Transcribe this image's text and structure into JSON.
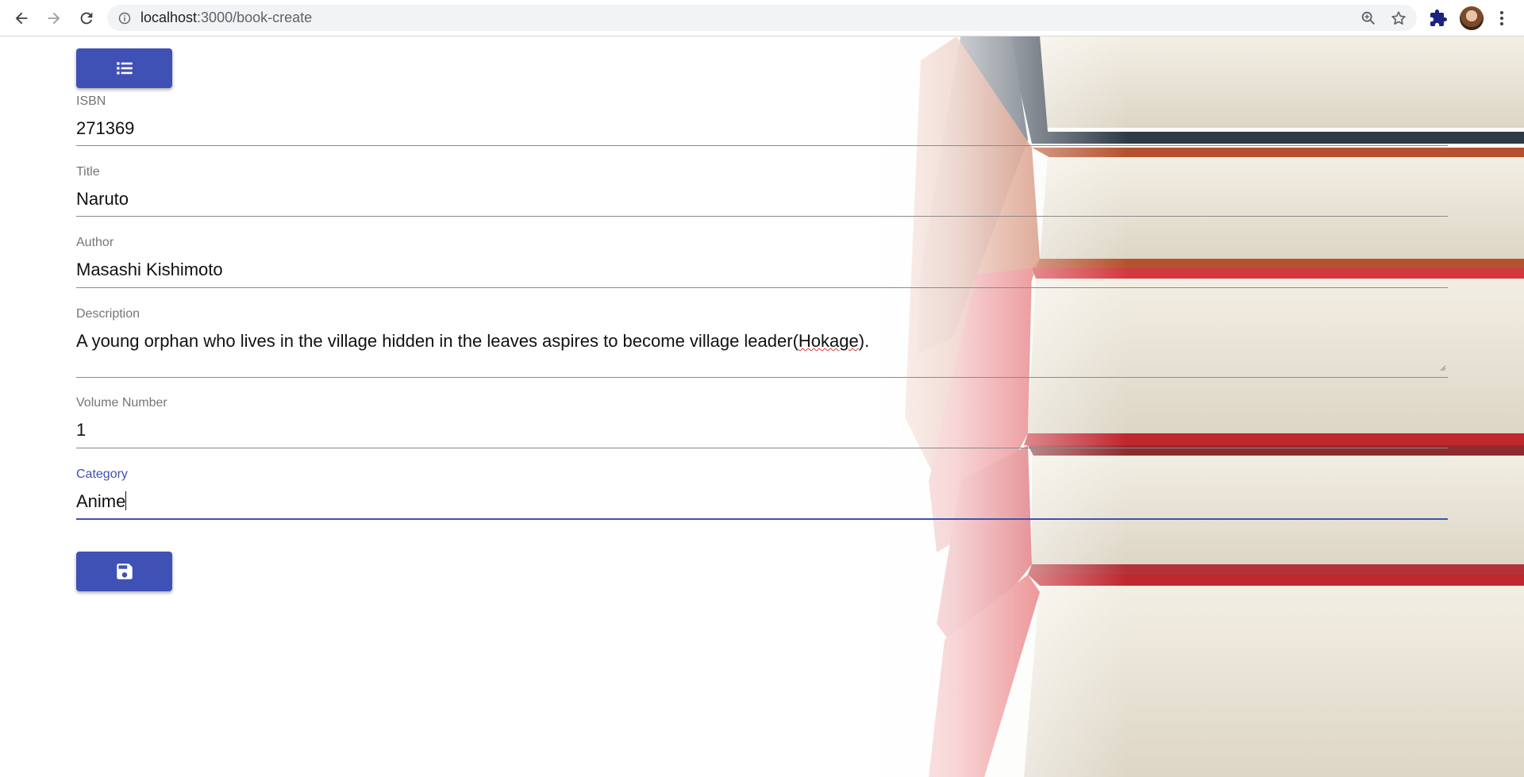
{
  "browser": {
    "url_host": "localhost",
    "url_path": ":3000/book-create"
  },
  "form": {
    "fields": [
      {
        "label": "ISBN",
        "value": "271369"
      },
      {
        "label": "Title",
        "value": "Naruto"
      },
      {
        "label": "Author",
        "value": "Masashi Kishimoto"
      },
      {
        "label": "Description",
        "value_before": "A young orphan who lives in the village hidden in the leaves aspires to become village leader(",
        "value_flagged": "Hokage",
        "value_after": ")."
      },
      {
        "label": "Volume Number",
        "value": "1"
      },
      {
        "label": "Category",
        "value": "Anime"
      }
    ]
  },
  "icons": {
    "list_button": "list-icon",
    "save_button": "save-icon"
  },
  "colors": {
    "primary": "#3f51b5",
    "underline": "#8a8a8a",
    "label": "#757575"
  }
}
